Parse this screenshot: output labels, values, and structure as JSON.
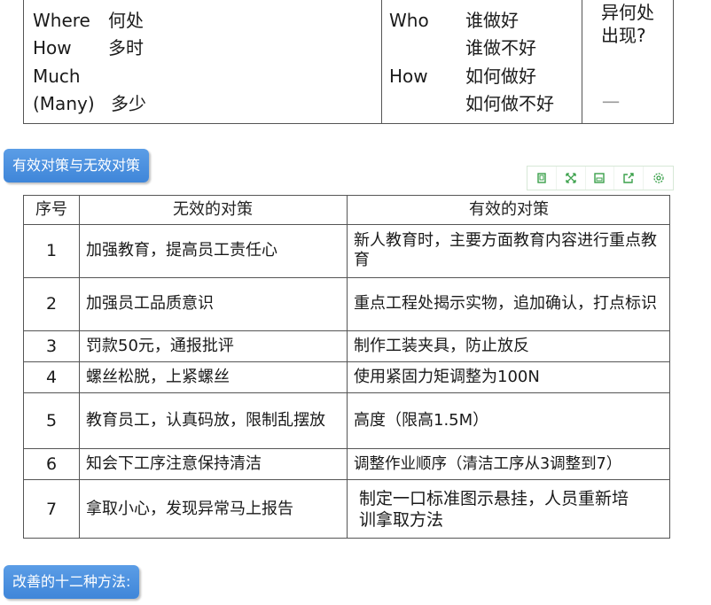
{
  "top_table": {
    "left_labels": [
      "Where",
      "How",
      "Much",
      "(Many)"
    ],
    "left_values": [
      "何处",
      "多时",
      "多少"
    ],
    "clipped_top": [
      "…",
      "…",
      "…"
    ],
    "right_labels": [
      "Who",
      "How"
    ],
    "right_values": [
      "谁做好",
      "谁做不好",
      "如何做好",
      "如何做不好"
    ],
    "far_right": "异何处出现?",
    "far_right_dash": "一"
  },
  "section1": {
    "title": "有效对策与无效对策"
  },
  "toolbar": {
    "icons": [
      "copy-icon",
      "fullscreen-icon",
      "save-icon",
      "share-icon",
      "settings-icon"
    ]
  },
  "table": {
    "headers": [
      "序号",
      "无效的对策",
      "有效的对策"
    ],
    "rows": [
      {
        "no": "1",
        "invalid": "加强教育，提高员工责任心",
        "valid": "新人教育时，主要方面教育内容进行重点教育"
      },
      {
        "no": "2",
        "invalid": "加强员工品质意识",
        "valid": "重点工程处揭示实物，追加确认，打点标识"
      },
      {
        "no": "3",
        "invalid": "罚款50元，通报批评",
        "valid": "制作工装夹具，防止放反"
      },
      {
        "no": "4",
        "invalid": "螺丝松脱，上紧螺丝",
        "valid": "使用紧固力矩调整为100N"
      },
      {
        "no": "5",
        "invalid": "教育员工，认真码放，限制乱摆放",
        "valid": "高度（限高1.5M）"
      },
      {
        "no": "6",
        "invalid": "知会下工序注意保持清洁",
        "valid": "调整作业顺序（清洁工序从3调整到7）"
      },
      {
        "no": "7",
        "invalid": "拿取小心，发现异常马上报告",
        "valid": "制定一口标准图示悬挂，人员重新培训拿取方法"
      }
    ]
  },
  "section2": {
    "title": "改善的十二种方法:"
  },
  "colors": {
    "label_bg": "#4a90e2",
    "toolbar_icon": "#3aa04a",
    "border": "#555555"
  }
}
